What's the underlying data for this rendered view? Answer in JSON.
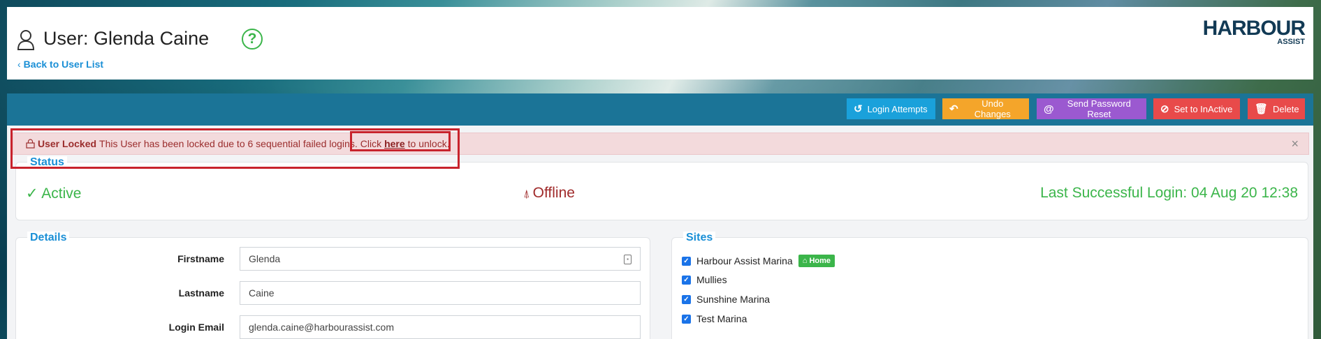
{
  "header": {
    "title": "User: Glenda Caine",
    "help_symbol": "?",
    "back_link": "Back to User List",
    "logo_main": "HARBOUR",
    "logo_sub": "ASSIST"
  },
  "toolbar": {
    "login_attempts": "Login Attempts",
    "undo_changes": "Undo Changes",
    "send_password_reset": "Send Password Reset",
    "set_inactive": "Set to InActive",
    "delete": "Delete"
  },
  "alert": {
    "title": "User Locked",
    "message": "This User has been locked due to 6 sequential failed logins.",
    "prefix": "Click",
    "link": "here",
    "suffix": "to unlock.",
    "close": "×"
  },
  "status": {
    "legend": "Status",
    "active": "Active",
    "offline": "Offline",
    "last_login": "Last Successful Login: 04 Aug 20 12:38"
  },
  "details": {
    "legend": "Details",
    "firstname_label": "Firstname",
    "firstname_value": "Glenda",
    "lastname_label": "Lastname",
    "lastname_value": "Caine",
    "email_label": "Login Email",
    "email_value": "glenda.caine@harbourassist.com"
  },
  "sites": {
    "legend": "Sites",
    "items": [
      {
        "label": "Harbour Assist Marina",
        "checked": true,
        "badge": "Home"
      },
      {
        "label": "Mullies",
        "checked": true
      },
      {
        "label": "Sunshine Marina",
        "checked": true
      },
      {
        "label": "Test Marina",
        "checked": true
      }
    ]
  },
  "colors": {
    "toolbar": "#1b7497",
    "accent": "#1a8fd6",
    "success": "#3bb54a",
    "danger": "#e84a4a",
    "warning": "#f4a52a",
    "purple": "#9b59d0",
    "info": "#1aa1db"
  }
}
